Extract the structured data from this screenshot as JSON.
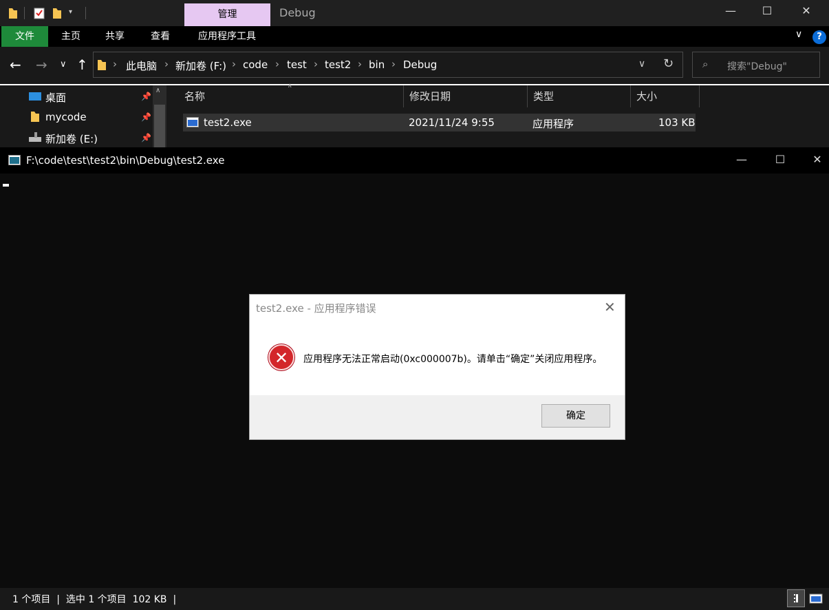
{
  "explorer": {
    "contextual_tab": "管理",
    "window_title": "Debug",
    "ribbon_tabs": [
      "文件",
      "主页",
      "共享",
      "查看",
      "应用程序工具"
    ],
    "help_label": "?",
    "breadcrumb": [
      "此电脑",
      "新加卷 (F:)",
      "code",
      "test",
      "test2",
      "bin",
      "Debug"
    ],
    "search_placeholder": "搜索\"Debug\"",
    "nav_items": [
      "桌面",
      "mycode",
      "新加卷 (E:)"
    ],
    "columns": [
      "名称",
      "修改日期",
      "类型",
      "大小"
    ],
    "files": [
      {
        "name": "test2.exe",
        "modified": "2021/11/24 9:55",
        "type": "应用程序",
        "size": "103 KB"
      }
    ],
    "status": "1 个项目  |  选中 1 个项目  102 KB  |"
  },
  "console": {
    "title": "F:\\code\\test\\test2\\bin\\Debug\\test2.exe"
  },
  "dialog": {
    "title": "test2.exe - 应用程序错误",
    "message": "应用程序无法正常启动(0xc000007b)。请单击“确定”关闭应用程序。",
    "ok_label": "确定"
  },
  "colors": {
    "file_tab": "#1e8a3a",
    "manage_tab": "#e6c8f2",
    "error_red": "#d3262a"
  }
}
